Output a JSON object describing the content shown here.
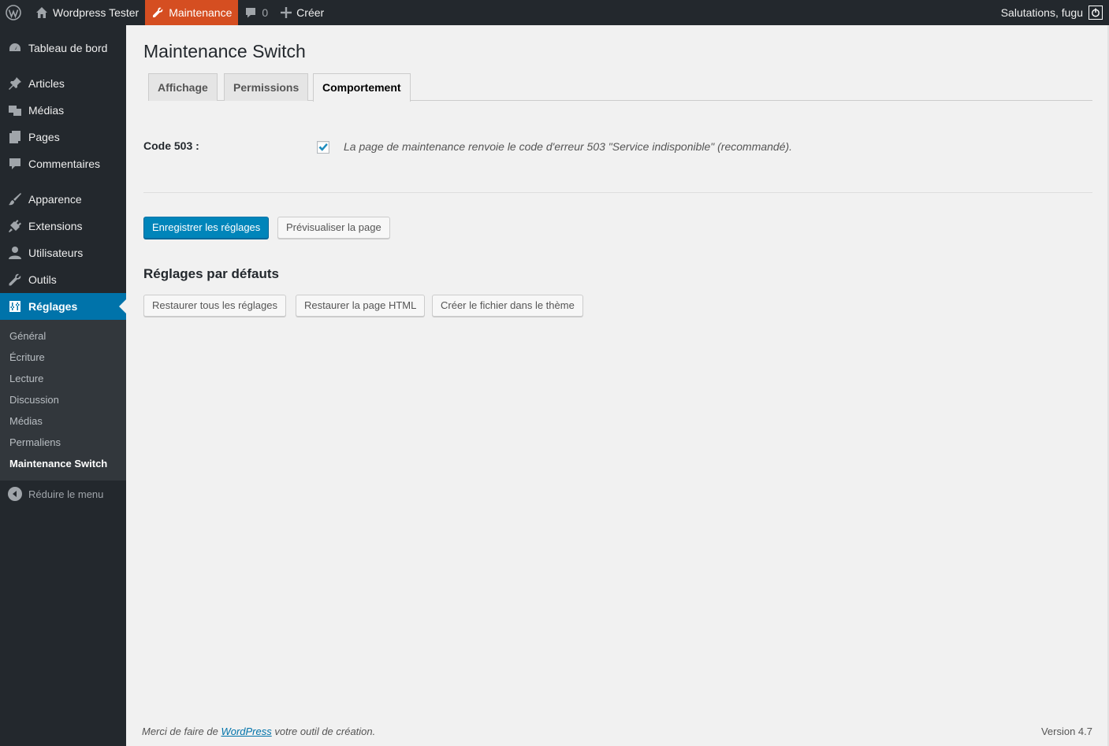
{
  "adminbar": {
    "site_name": "Wordpress Tester",
    "maintenance_label": "Maintenance",
    "comments_count": "0",
    "new_label": "Créer",
    "greeting": "Salutations, fugu"
  },
  "sidebar": {
    "items": [
      {
        "label": "Tableau de bord",
        "icon": "dashboard-icon"
      },
      {
        "label": "Articles",
        "icon": "pin-icon"
      },
      {
        "label": "Médias",
        "icon": "media-icon"
      },
      {
        "label": "Pages",
        "icon": "pages-icon"
      },
      {
        "label": "Commentaires",
        "icon": "comment-icon"
      },
      {
        "label": "Apparence",
        "icon": "brush-icon"
      },
      {
        "label": "Extensions",
        "icon": "plugin-icon"
      },
      {
        "label": "Utilisateurs",
        "icon": "user-icon"
      },
      {
        "label": "Outils",
        "icon": "wrench-icon"
      },
      {
        "label": "Réglages",
        "icon": "settings-icon"
      }
    ],
    "submenu": [
      "Général",
      "Écriture",
      "Lecture",
      "Discussion",
      "Médias",
      "Permaliens",
      "Maintenance Switch"
    ],
    "collapse_label": "Réduire le menu"
  },
  "page": {
    "title": "Maintenance Switch",
    "tabs": [
      "Affichage",
      "Permissions",
      "Comportement"
    ],
    "field_label": "Code 503 :",
    "checkbox_checked": true,
    "field_description": "La page de maintenance renvoie le code d'erreur 503 \"Service indisponible\" (recommandé).",
    "save_button": "Enregistrer les réglages",
    "preview_button": "Prévisualiser la page",
    "defaults_heading": "Réglages par défauts",
    "restore_all_button": "Restaurer tous les réglages",
    "restore_html_button": "Restaurer la page HTML",
    "create_file_button": "Créer le fichier dans le thème"
  },
  "footer": {
    "text_before": "Merci de faire de ",
    "link": "WordPress",
    "text_after": " votre outil de création.",
    "version": "Version 4.7"
  },
  "colors": {
    "admin_bar": "#23282d",
    "accent": "#0073aa",
    "maintenance": "#d54e21",
    "primary_button": "#0085ba"
  }
}
